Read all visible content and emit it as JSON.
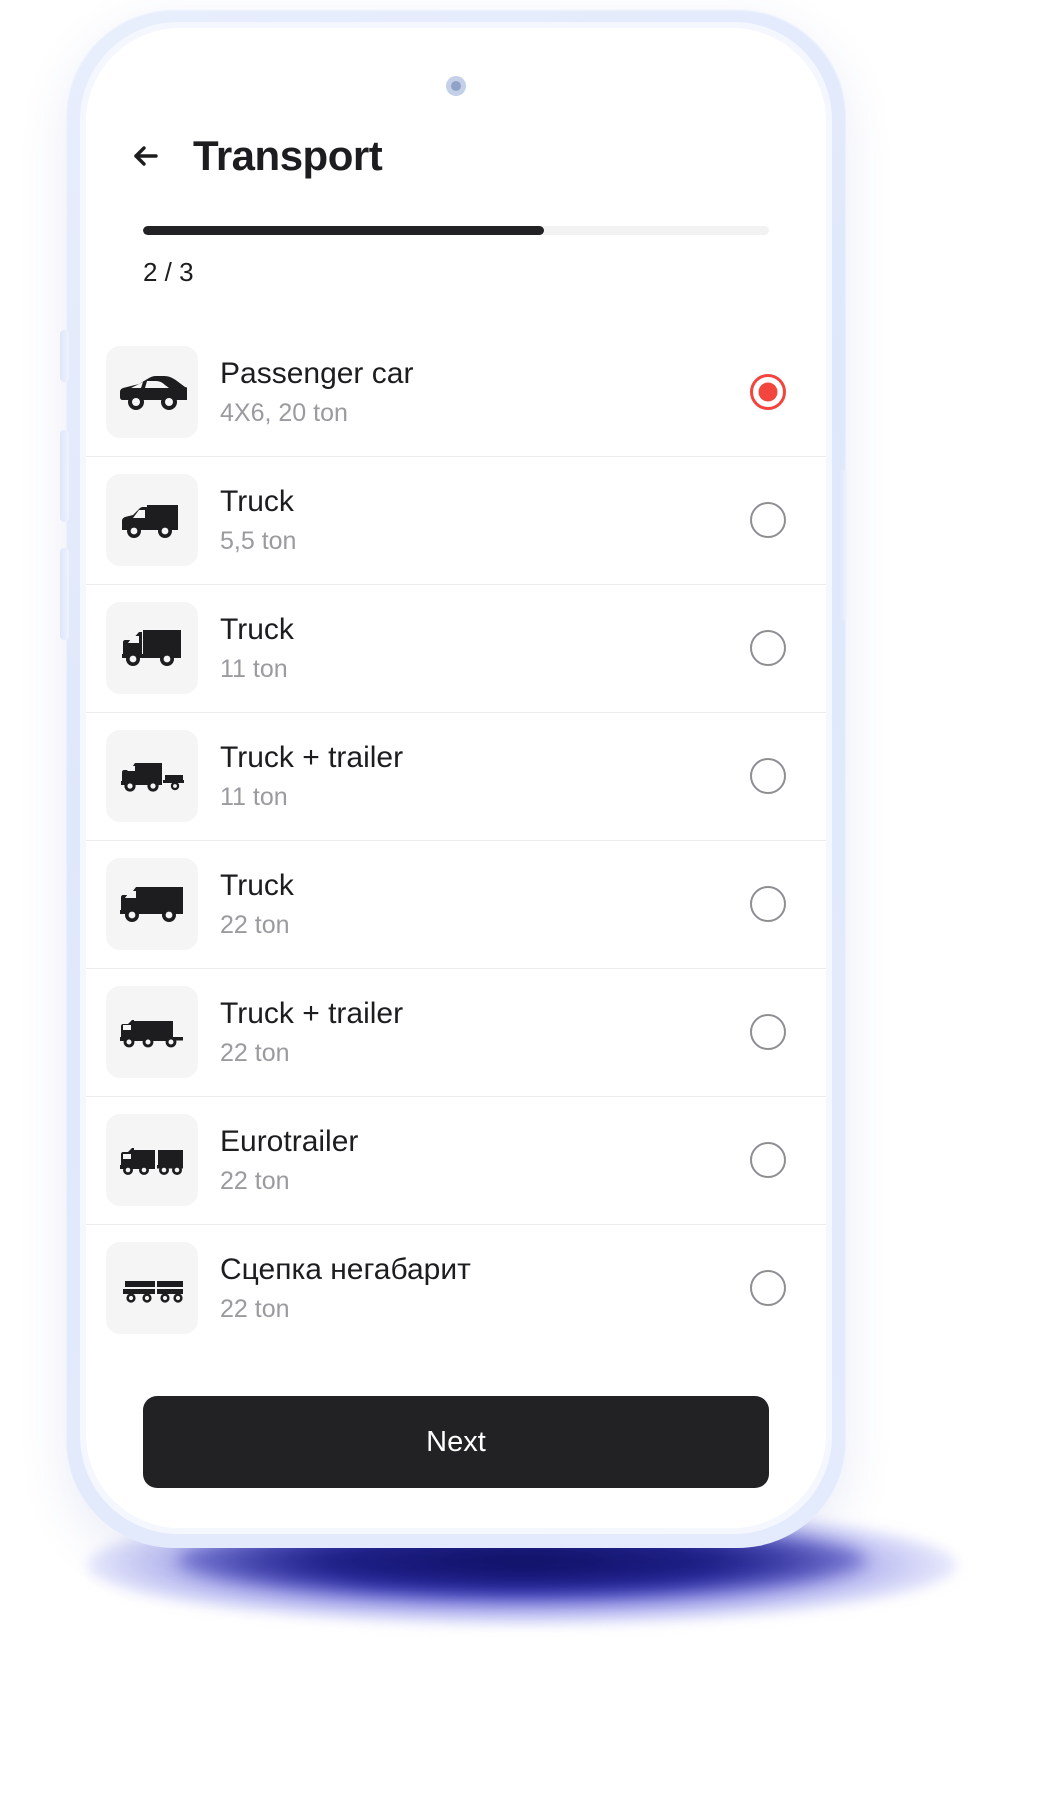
{
  "header": {
    "back_icon": "arrow-left-icon",
    "title": "Transport"
  },
  "progress": {
    "percent": 64,
    "step_label": "2 / 3"
  },
  "colors": {
    "accent_selected": "#F2453D",
    "primary_dark": "#222224",
    "muted_text": "#9A9A9F",
    "thumb_bg": "#F5F5F6"
  },
  "list": {
    "items": [
      {
        "icon": "passenger-car-icon",
        "title": "Passenger car",
        "subtitle": "4X6, 20 ton",
        "selected": true
      },
      {
        "icon": "small-box-truck-icon",
        "title": "Truck",
        "subtitle": "5,5 ton",
        "selected": false
      },
      {
        "icon": "box-truck-icon",
        "title": "Truck",
        "subtitle": "11 ton",
        "selected": false
      },
      {
        "icon": "truck-trailer-icon",
        "title": "Truck + trailer",
        "subtitle": "11 ton",
        "selected": false
      },
      {
        "icon": "large-box-truck-icon",
        "title": "Truck",
        "subtitle": "22 ton",
        "selected": false
      },
      {
        "icon": "semi-trailer-icon",
        "title": "Truck + trailer",
        "subtitle": "22 ton",
        "selected": false
      },
      {
        "icon": "eurotrailer-icon",
        "title": "Eurotrailer",
        "subtitle": "22 ton",
        "selected": false
      },
      {
        "icon": "oversize-rig-icon",
        "title": "Сцепка негабарит",
        "subtitle": "22 ton",
        "selected": false
      }
    ]
  },
  "footer": {
    "next_label": "Next"
  }
}
